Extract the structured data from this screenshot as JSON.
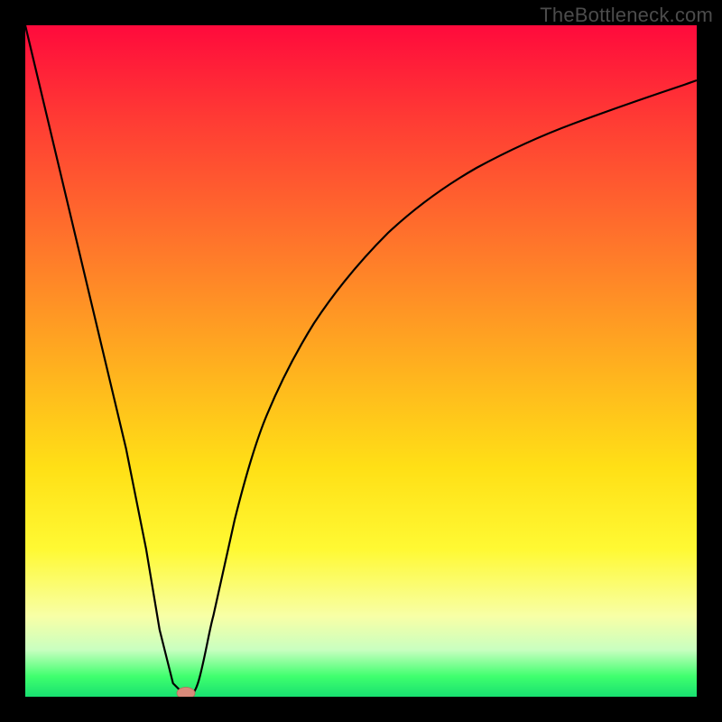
{
  "watermark": "TheBottleneck.com",
  "chart_data": {
    "type": "line",
    "title": "",
    "xlabel": "",
    "ylabel": "",
    "xlim": [
      0,
      100
    ],
    "ylim": [
      0,
      100
    ],
    "grid": false,
    "legend": false,
    "background_gradient": {
      "orientation": "vertical",
      "stops": [
        {
          "pos": 0.0,
          "color": "#ff0a3c"
        },
        {
          "pos": 0.14,
          "color": "#ff3b34"
        },
        {
          "pos": 0.34,
          "color": "#ff7a2a"
        },
        {
          "pos": 0.52,
          "color": "#ffb41e"
        },
        {
          "pos": 0.66,
          "color": "#ffe016"
        },
        {
          "pos": 0.78,
          "color": "#fff933"
        },
        {
          "pos": 0.88,
          "color": "#f8ffa6"
        },
        {
          "pos": 0.93,
          "color": "#c9ffc0"
        },
        {
          "pos": 0.97,
          "color": "#3fff6e"
        },
        {
          "pos": 1.0,
          "color": "#18e070"
        }
      ]
    },
    "series": [
      {
        "name": "bottleneck-curve",
        "color": "#000000",
        "x": [
          0,
          5,
          10,
          15,
          18,
          20,
          22,
          24,
          26,
          28,
          30,
          33,
          36,
          40,
          45,
          50,
          55,
          60,
          65,
          70,
          75,
          80,
          85,
          90,
          95,
          100
        ],
        "y": [
          100,
          79,
          58,
          37,
          22,
          10,
          2,
          0,
          3,
          12,
          25,
          40,
          50,
          60,
          69,
          75,
          80,
          83,
          86,
          88,
          90,
          91.5,
          92.5,
          93.3,
          94,
          94.5
        ]
      }
    ],
    "markers": [
      {
        "name": "min-point",
        "x": 24,
        "y": 0,
        "color": "#d88a7a",
        "shape": "ellipse"
      }
    ]
  },
  "plot_frame": {
    "border_color": "#000000",
    "border_width_px": 28
  }
}
